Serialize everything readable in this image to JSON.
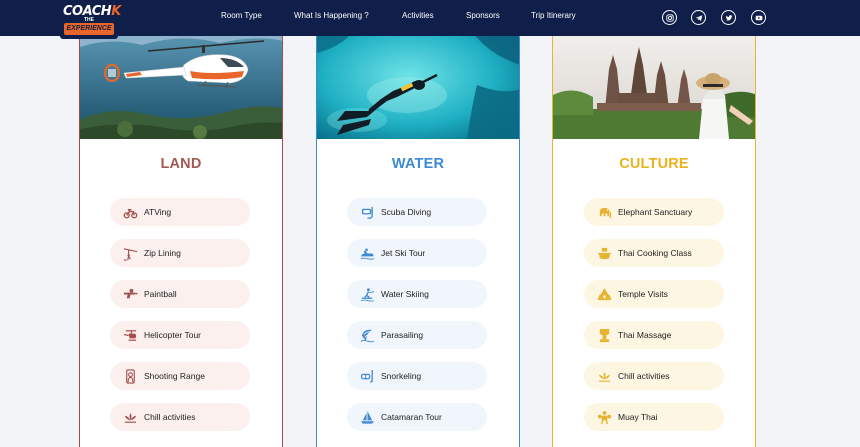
{
  "logo": {
    "top": "COACH",
    "k": "K",
    "the": "THE",
    "bottom": "EXPERIENCE"
  },
  "nav": [
    "Room Type",
    "What Is Happening ?",
    "Activities",
    "Sponsors",
    "Trip Itinerary"
  ],
  "social": [
    "instagram-icon",
    "telegram-icon",
    "twitter-icon",
    "youtube-icon"
  ],
  "colors": {
    "nav": "#0f1f4a",
    "land": "#a24d4a",
    "water": "#3e8ad3",
    "culture": "#e7b431"
  },
  "cards": [
    {
      "title": "LAND",
      "items": [
        {
          "label": "ATVing",
          "icon": "atv-icon"
        },
        {
          "label": "Zip Lining",
          "icon": "zipline-icon"
        },
        {
          "label": "Paintball",
          "icon": "paintball-gun-icon"
        },
        {
          "label": "Helicopter Tour",
          "icon": "helicopter-icon"
        },
        {
          "label": "Shooting Range",
          "icon": "target-icon"
        },
        {
          "label": "Chill activities",
          "icon": "lotus-icon"
        }
      ]
    },
    {
      "title": "WATER",
      "items": [
        {
          "label": "Scuba Diving",
          "icon": "diving-mask-icon"
        },
        {
          "label": "Jet Ski Tour",
          "icon": "jet-ski-icon"
        },
        {
          "label": "Water Skiing",
          "icon": "water-ski-icon"
        },
        {
          "label": "Parasailing",
          "icon": "parasail-icon"
        },
        {
          "label": "Snorkeling",
          "icon": "snorkel-icon"
        },
        {
          "label": "Catamaran Tour",
          "icon": "sailboat-icon"
        }
      ]
    },
    {
      "title": "CULTURE",
      "items": [
        {
          "label": "Elephant Sanctuary",
          "icon": "elephant-icon"
        },
        {
          "label": "Thai Cooking Class",
          "icon": "cooking-pot-icon"
        },
        {
          "label": "Temple Visits",
          "icon": "temple-icon"
        },
        {
          "label": "Thai Massage",
          "icon": "massage-icon"
        },
        {
          "label": "Chill activities",
          "icon": "lotus-icon"
        },
        {
          "label": "Muay Thai",
          "icon": "boxer-icon"
        }
      ]
    }
  ]
}
